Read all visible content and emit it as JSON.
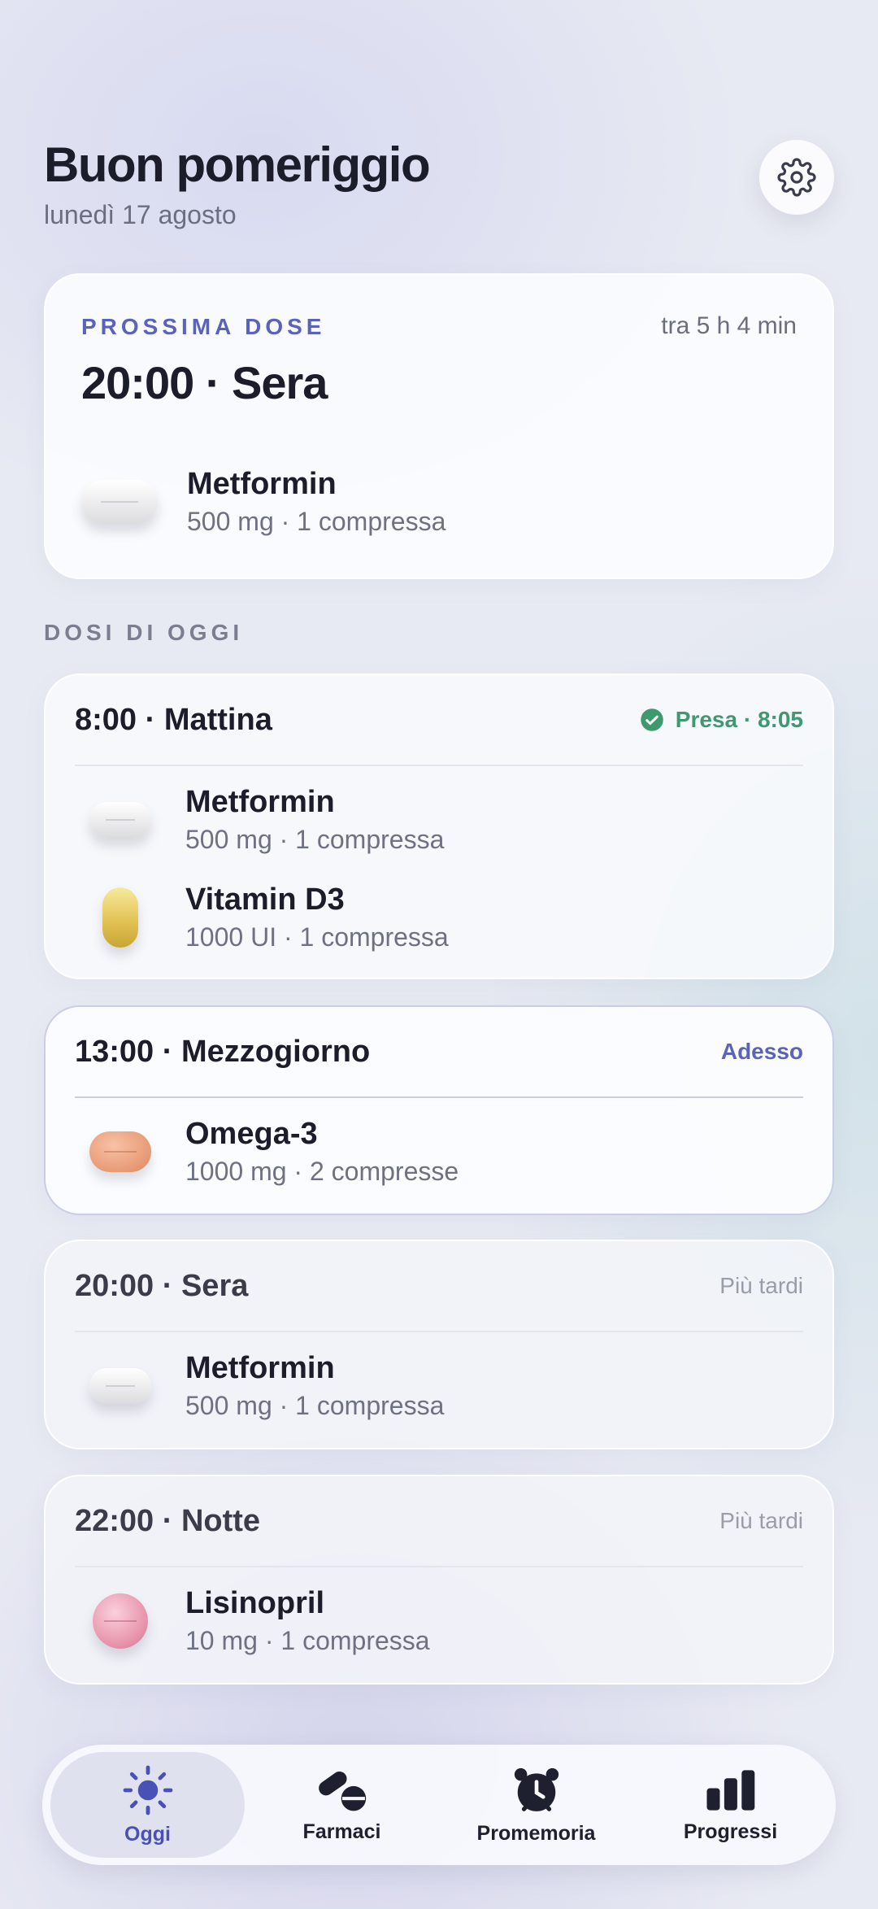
{
  "header": {
    "greeting": "Buon pomeriggio",
    "date": "lunedì 17 agosto"
  },
  "next_dose": {
    "label": "PROSSIMA DOSE",
    "eta": "tra 5 h 4 min",
    "time": "20:00 · Sera",
    "med": {
      "name": "Metformin",
      "detail": "500 mg · 1 compressa"
    }
  },
  "section_label": "DOSI DI OGGI",
  "doses": [
    {
      "title": "8:00 · Mattina",
      "status": "Presa · 8:05",
      "status_color": "#3e9a6e",
      "meds": [
        {
          "name": "Metformin",
          "detail": "500 mg · 1 compressa"
        },
        {
          "name": "Vitamin D3",
          "detail": "1000 UI · 1 compressa"
        }
      ]
    },
    {
      "title": "13:00 · Mezzogiorno",
      "status": "Adesso",
      "status_color": "#5b63b8",
      "meds": [
        {
          "name": "Omega-3",
          "detail": "1000 mg · 2 compresse"
        }
      ]
    },
    {
      "title": "20:00 · Sera",
      "status": "Più tardi",
      "status_color": "#9a9caa",
      "meds": [
        {
          "name": "Metformin",
          "detail": "500 mg · 1 compressa"
        }
      ]
    },
    {
      "title": "22:00 · Notte",
      "status": "Più tardi",
      "status_color": "#9a9caa",
      "meds": [
        {
          "name": "Lisinopril",
          "detail": "10 mg · 1 compressa"
        }
      ]
    }
  ],
  "tabs": [
    {
      "label": "Oggi",
      "icon": "sun-icon",
      "active": true
    },
    {
      "label": "Farmaci",
      "icon": "pills-icon",
      "active": false
    },
    {
      "label": "Promemoria",
      "icon": "alarm-clock-icon",
      "active": false
    },
    {
      "label": "Progressi",
      "icon": "bar-chart-icon",
      "active": false
    }
  ],
  "colors": {
    "accent": "#5b63b8",
    "taken": "#3e9a6e",
    "later": "#9a9caa"
  }
}
